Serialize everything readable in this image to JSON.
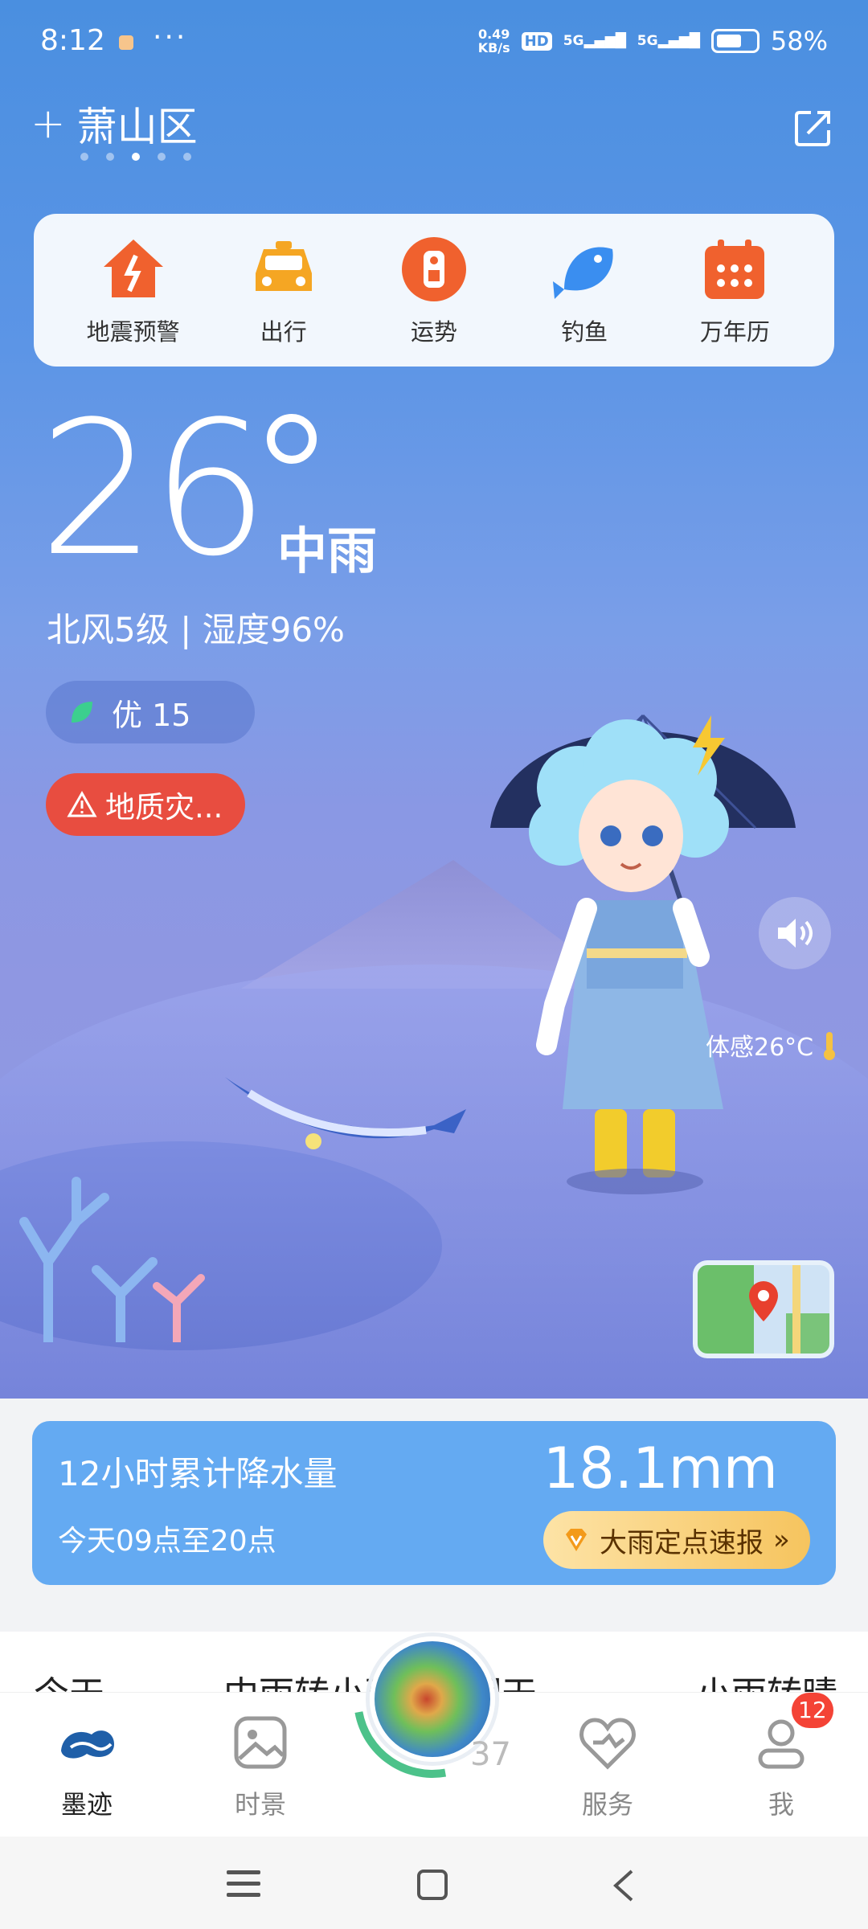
{
  "status_bar": {
    "time": "8:12",
    "more": "···",
    "net_speed_value": "0.49",
    "net_speed_unit": "KB/s",
    "hd_badge": "HD",
    "signal_1": "5G",
    "signal_2": "5G",
    "battery": "58%",
    "battery_level": 0.58
  },
  "location": {
    "add": "+",
    "name": "萧山区",
    "page_count": 5,
    "active_page": 3
  },
  "quick_actions": [
    {
      "label": "地震预警",
      "icon": "earthquake-house-icon",
      "color": "#f0612e"
    },
    {
      "label": "出行",
      "icon": "taxi-icon",
      "color": "#f5a623"
    },
    {
      "label": "运势",
      "icon": "fortune-icon",
      "color": "#f0612e"
    },
    {
      "label": "钓鱼",
      "icon": "fish-icon",
      "color": "#3a8ef0"
    },
    {
      "label": "万年历",
      "icon": "calendar-icon",
      "color": "#f0612e"
    }
  ],
  "current": {
    "temperature": "26",
    "condition": "中雨",
    "wind": "北风5级",
    "separator": "|",
    "humidity": "湿度96%",
    "aqi": "优 15",
    "alert": "地质灾...",
    "feels_like": "体感26°C"
  },
  "precip_card": {
    "title": "12小时累计降水量",
    "value": "18.1mm",
    "period": "今天09点至20点",
    "button": "大雨定点速报",
    "button_arrow": "»"
  },
  "forecast_peek": [
    "今天",
    "中雨转小雨",
    "明天",
    "小雨转晴"
  ],
  "forecast_peek_temp": "37",
  "tabbar": [
    {
      "label": "墨迹",
      "icon": "moji-logo-icon",
      "active": true
    },
    {
      "label": "时景",
      "icon": "gallery-icon",
      "active": false
    },
    {
      "label": "服务",
      "icon": "service-heart-icon",
      "active": false
    },
    {
      "label": "我",
      "icon": "profile-icon",
      "active": false
    }
  ],
  "tabbar_badge": "12",
  "colors": {
    "alert": "#e84d40",
    "precip_card": "#64aaf2",
    "accent_orange": "#f0612e"
  }
}
